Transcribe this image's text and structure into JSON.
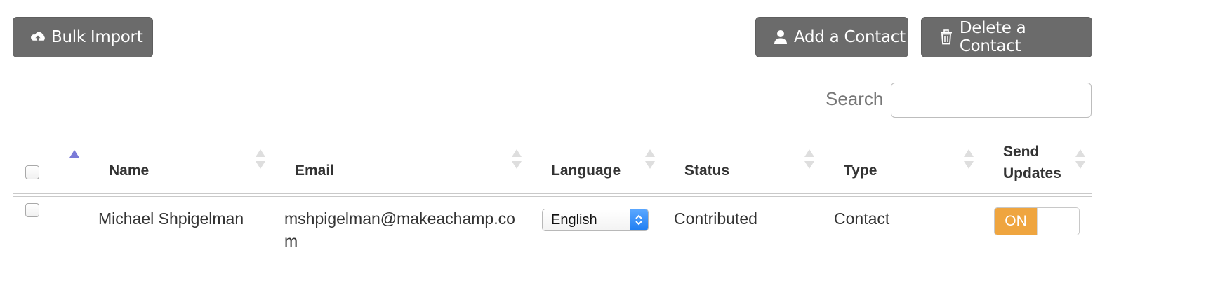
{
  "toolbar": {
    "bulk_import_label": "Bulk Import",
    "add_contact_label": "Add a Contact",
    "delete_contact_label": "Delete a Contact",
    "button_color": "#6b6b6b",
    "icons": {
      "bulk_import": "cloud-upload-icon",
      "add_contact": "user-icon",
      "delete_contact": "trash-icon"
    }
  },
  "search": {
    "label": "Search",
    "value": "",
    "placeholder": ""
  },
  "table": {
    "columns": [
      {
        "label": "",
        "sorted": "ascending"
      },
      {
        "label": "Name"
      },
      {
        "label": "Email"
      },
      {
        "label": "Language"
      },
      {
        "label": "Status"
      },
      {
        "label": "Type"
      },
      {
        "label": "Send Updates"
      }
    ],
    "sort_active_color": "#7b7bd8",
    "rows": [
      {
        "checked": false,
        "name": "Michael Shpigelman",
        "email": "mshpigelman@makeachamp.com",
        "language": "English",
        "status": "Contributed",
        "type": "Contact",
        "send_updates": "ON",
        "send_updates_color": "#efa53f"
      }
    ]
  }
}
